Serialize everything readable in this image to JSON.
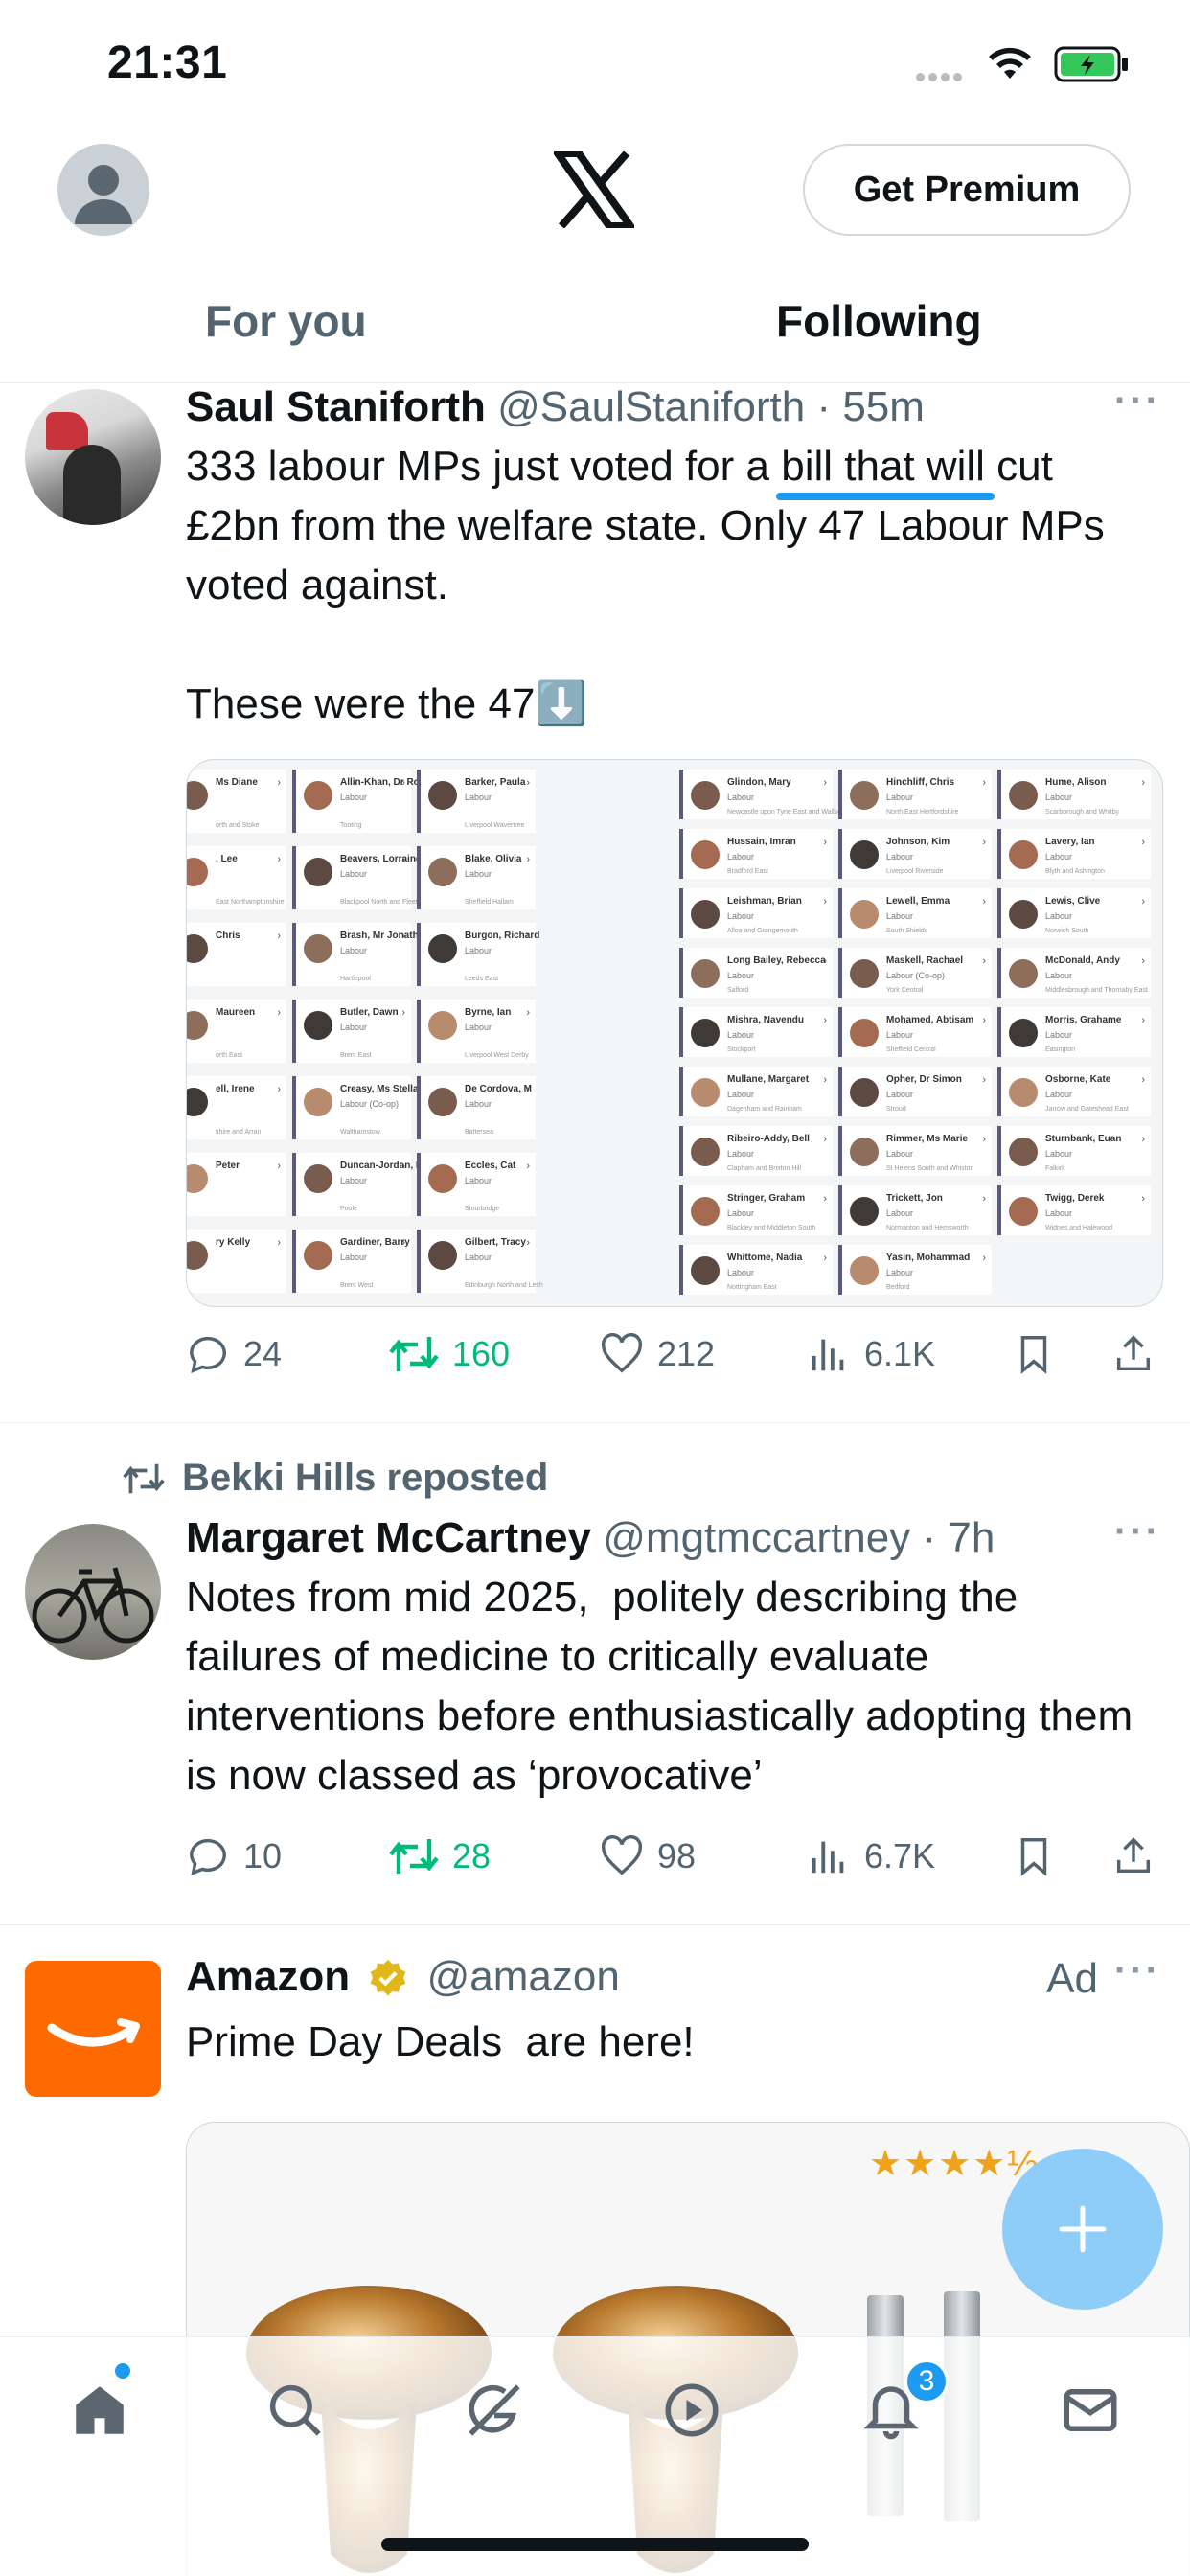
{
  "status_bar": {
    "time": "21:31"
  },
  "header": {
    "premium_label": "Get Premium",
    "tabs": [
      {
        "label": "For you",
        "active": false
      },
      {
        "label": "Following",
        "active": true
      }
    ]
  },
  "tweets": [
    {
      "name": "Saul Staniforth",
      "handle": "@SaulStaniforth",
      "time": "55m",
      "text": "333 labour MPs just voted for a bill that will cut £2bn from the welfare state. Only 47 Labour MPs voted against.\n\nThese were the 47⬇️",
      "stats": {
        "replies": "24",
        "reposts": "160",
        "likes": "212",
        "views": "6.1K"
      },
      "media_left": [
        {
          "name": "Ms Diane",
          "party": "",
          "seat": "orth and Stoke"
        },
        {
          "name": ", Lee",
          "party": "",
          "seat": "East Northamptonshire"
        },
        {
          "name": "Chris",
          "party": "",
          "seat": ""
        },
        {
          "name": "Maureen",
          "party": "",
          "seat": "orth East"
        },
        {
          "name": "ell, Irene",
          "party": "",
          "seat": "shire and Arran"
        },
        {
          "name": "Peter",
          "party": "",
          "seat": ""
        },
        {
          "name": "ry Kelly",
          "party": "",
          "seat": ""
        },
        {
          "name": "Allin-Khan, Dr Rosena",
          "party": "Labour",
          "seat": "Tooting"
        },
        {
          "name": "Beavers, Lorraine",
          "party": "Labour",
          "seat": "Blackpool North and Fleetwood"
        },
        {
          "name": "Brash, Mr Jonathan",
          "party": "Labour",
          "seat": "Hartlepool"
        },
        {
          "name": "Butler, Dawn",
          "party": "Labour",
          "seat": "Brent East"
        },
        {
          "name": "Creasy, Ms Stella",
          "party": "Labour (Co-op)",
          "seat": "Walthamstow"
        },
        {
          "name": "Duncan-Jordan, Neil",
          "party": "Labour",
          "seat": "Poole"
        },
        {
          "name": "Gardiner, Barry",
          "party": "Labour",
          "seat": "Brent West"
        },
        {
          "name": "Barker, Paula",
          "party": "Labour",
          "seat": "Liverpool Wavertree"
        },
        {
          "name": "Blake, Olivia",
          "party": "Labour",
          "seat": "Sheffield Hallam"
        },
        {
          "name": "Burgon, Richard",
          "party": "Labour",
          "seat": "Leeds East"
        },
        {
          "name": "Byrne, Ian",
          "party": "Labour",
          "seat": "Liverpool West Derby"
        },
        {
          "name": "De Cordova, M",
          "party": "Labour",
          "seat": "Battersea"
        },
        {
          "name": "Eccles, Cat",
          "party": "Labour",
          "seat": "Stourbridge"
        },
        {
          "name": "Gilbert, Tracy",
          "party": "Labour",
          "seat": "Edinburgh North and Leith"
        }
      ],
      "media_right": [
        {
          "name": "Glindon, Mary",
          "party": "Labour",
          "seat": "Newcastle upon Tyne East and Wallsend"
        },
        {
          "name": "Hussain, Imran",
          "party": "Labour",
          "seat": "Bradford East"
        },
        {
          "name": "Leishman, Brian",
          "party": "Labour",
          "seat": "Alloa and Grangemouth"
        },
        {
          "name": "Long Bailey, Rebecca",
          "party": "Labour",
          "seat": "Salford"
        },
        {
          "name": "Mishra, Navendu",
          "party": "Labour",
          "seat": "Stockport"
        },
        {
          "name": "Mullane, Margaret",
          "party": "Labour",
          "seat": "Dagenham and Rainham"
        },
        {
          "name": "Ribeiro-Addy, Bell",
          "party": "Labour",
          "seat": "Clapham and Brixton Hill"
        },
        {
          "name": "Stringer, Graham",
          "party": "Labour",
          "seat": "Blackley and Middleton South"
        },
        {
          "name": "Whittome, Nadia",
          "party": "Labour",
          "seat": "Nottingham East"
        },
        {
          "name": "Hinchliff, Chris",
          "party": "Labour",
          "seat": "North East Hertfordshire"
        },
        {
          "name": "Johnson, Kim",
          "party": "Labour",
          "seat": "Liverpool Riverside"
        },
        {
          "name": "Lewell, Emma",
          "party": "Labour",
          "seat": "South Shields"
        },
        {
          "name": "Maskell, Rachael",
          "party": "Labour (Co-op)",
          "seat": "York Central"
        },
        {
          "name": "Mohamed, Abtisam",
          "party": "Labour",
          "seat": "Sheffield Central"
        },
        {
          "name": "Opher, Dr Simon",
          "party": "Labour",
          "seat": "Stroud"
        },
        {
          "name": "Rimmer, Ms Marie",
          "party": "Labour",
          "seat": "St Helens South and Whiston"
        },
        {
          "name": "Trickett, Jon",
          "party": "Labour",
          "seat": "Normanton and Hemsworth"
        },
        {
          "name": "Yasin, Mohammad",
          "party": "Labour",
          "seat": "Bedford"
        },
        {
          "name": "Hume, Alison",
          "party": "Labour",
          "seat": "Scarborough and Whitby"
        },
        {
          "name": "Lavery, Ian",
          "party": "Labour",
          "seat": "Blyth and Ashington"
        },
        {
          "name": "Lewis, Clive",
          "party": "Labour",
          "seat": "Norwich South"
        },
        {
          "name": "McDonald, Andy",
          "party": "Labour",
          "seat": "Middlesbrough and Thornaby East"
        },
        {
          "name": "Morris, Grahame",
          "party": "Labour",
          "seat": "Easington"
        },
        {
          "name": "Osborne, Kate",
          "party": "Labour",
          "seat": "Jarrow and Gateshead East"
        },
        {
          "name": "Sturnbank, Euan",
          "party": "Labour",
          "seat": "Falkirk"
        },
        {
          "name": "Twigg, Derek",
          "party": "Labour",
          "seat": "Widnes and Halewood"
        }
      ]
    },
    {
      "reposted_by": "Bekki Hills reposted",
      "name": "Margaret McCartney",
      "handle": "@mgtmccartney",
      "time": "7h",
      "text": "Notes from mid 2025,  politely describing the failures of medicine to critically evaluate interventions before enthusiastically adopting them is now classed as ‘provocative’",
      "stats": {
        "replies": "10",
        "reposts": "28",
        "likes": "98",
        "views": "6.7K"
      }
    },
    {
      "name": "Amazon",
      "handle": "@amazon",
      "ad_label": "Ad",
      "text": "Prime Day Deals  are here!",
      "rating": "★★★★½"
    }
  ],
  "bottom_nav": {
    "notification_count": "3"
  },
  "colors": {
    "accent": "#1d9bf0",
    "repost_green": "#00ba7c",
    "amazon_orange": "#ff6a00"
  }
}
